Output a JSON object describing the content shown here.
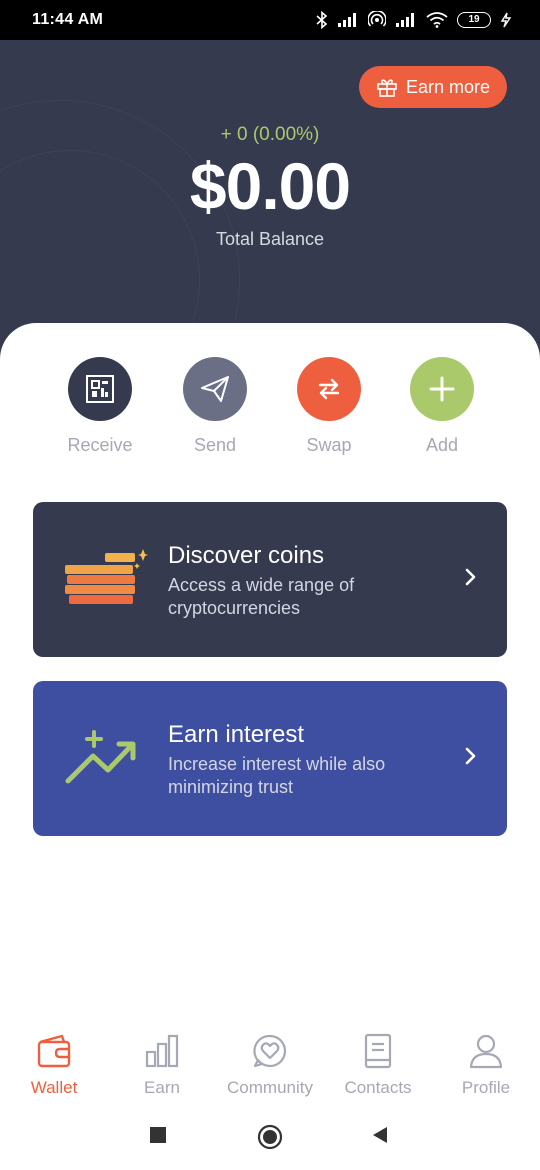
{
  "status_bar": {
    "time": "11:44 AM",
    "battery": "19"
  },
  "header": {
    "earn_more_label": "Earn more",
    "change": "+ 0 (0.00%)",
    "balance": "$0.00",
    "balance_label": "Total Balance"
  },
  "actions": [
    {
      "label": "Receive",
      "icon": "qr-code-icon",
      "color": "#363a4f"
    },
    {
      "label": "Send",
      "icon": "paper-plane-icon",
      "color": "#6b6f86"
    },
    {
      "label": "Swap",
      "icon": "swap-arrows-icon",
      "color": "#ee5f3f"
    },
    {
      "label": "Add",
      "icon": "plus-icon",
      "color": "#a9c96b"
    }
  ],
  "cards": [
    {
      "title": "Discover coins",
      "description": "Access a wide range of cryptocurrencies",
      "color": "#363a4f"
    },
    {
      "title": "Earn interest",
      "description": "Increase interest while also minimizing trust",
      "color": "#3e4fa1"
    }
  ],
  "nav": [
    {
      "label": "Wallet",
      "icon": "wallet-icon",
      "active": true
    },
    {
      "label": "Earn",
      "icon": "bar-chart-icon",
      "active": false
    },
    {
      "label": "Community",
      "icon": "heart-chat-icon",
      "active": false
    },
    {
      "label": "Contacts",
      "icon": "contacts-book-icon",
      "active": false
    },
    {
      "label": "Profile",
      "icon": "user-icon",
      "active": false
    }
  ],
  "colors": {
    "accent": "#ee5f3f",
    "header_bg": "#363a4f",
    "positive": "#a9c96b",
    "muted_text": "#a6a8b3"
  }
}
